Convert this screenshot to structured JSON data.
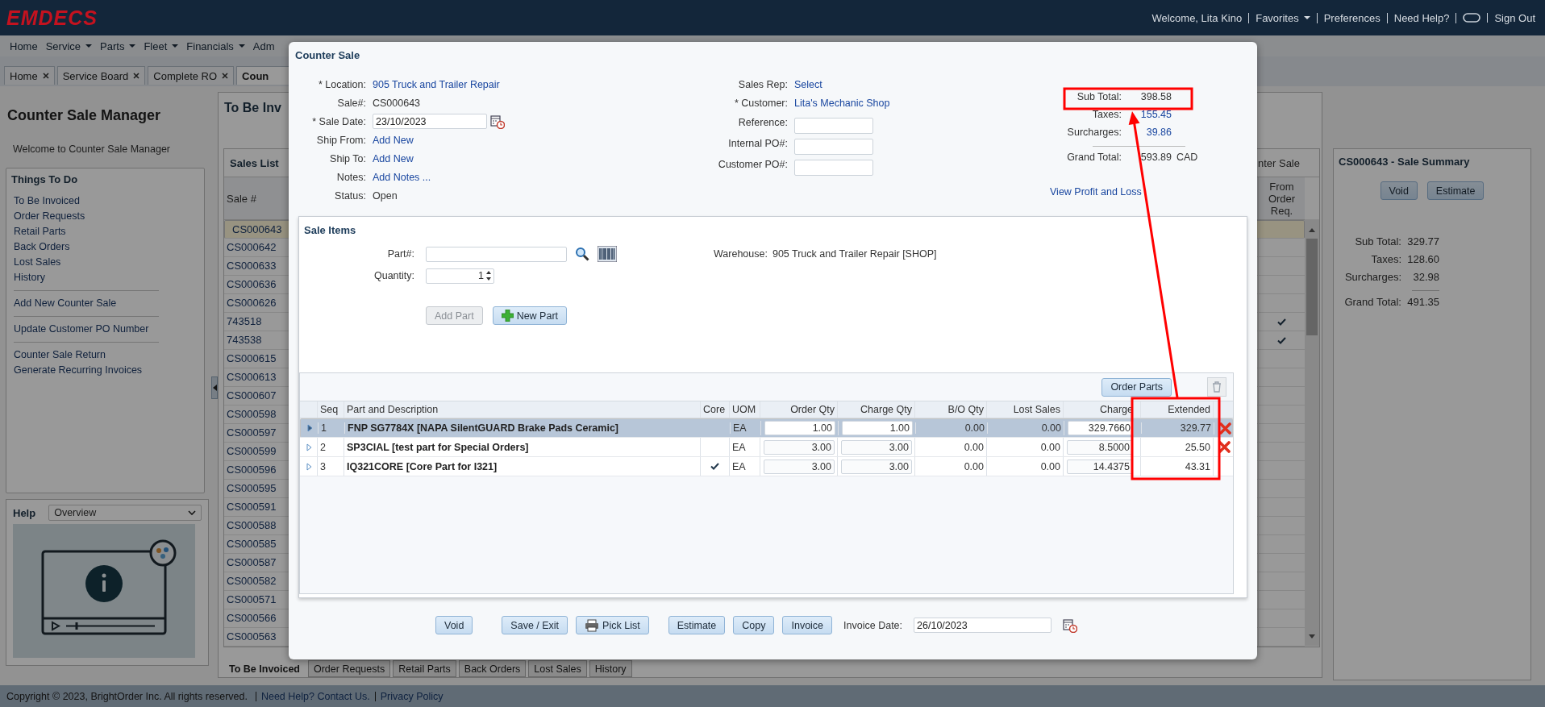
{
  "header": {
    "logo": "EMDECS",
    "links": [
      {
        "kind": "text",
        "text": "Welcome, Lita Kino"
      },
      {
        "kind": "menu",
        "text": "Favorites"
      },
      {
        "kind": "link",
        "text": "Preferences"
      },
      {
        "kind": "link",
        "text": "Need Help?"
      },
      {
        "kind": "icon"
      },
      {
        "kind": "link",
        "text": "Sign Out"
      }
    ]
  },
  "nav": [
    {
      "label": "Home",
      "menu": false
    },
    {
      "label": "Service",
      "menu": true
    },
    {
      "label": "Parts",
      "menu": true
    },
    {
      "label": "Fleet",
      "menu": true
    },
    {
      "label": "Financials",
      "menu": true
    },
    {
      "label": "Adm",
      "menu": false
    }
  ],
  "page_tabs": [
    {
      "label": "Home",
      "closable": true,
      "selected": false
    },
    {
      "label": "Service Board",
      "closable": true,
      "selected": false
    },
    {
      "label": "Complete RO",
      "closable": true,
      "selected": false
    },
    {
      "label": "Coun",
      "closable": false,
      "selected": true
    }
  ],
  "manager": {
    "title": "Counter Sale Manager",
    "welcome": "Welcome to Counter Sale Manager",
    "todo_title": "Things To Do",
    "todo_groups": [
      [
        "To Be Invoiced",
        "Order Requests",
        "Retail Parts",
        "Back Orders",
        "Lost Sales",
        "History"
      ],
      [
        "Add New Counter Sale"
      ],
      [
        "Update Customer PO Number"
      ],
      [
        "Counter Sale Return",
        "Generate Recurring Invoices"
      ]
    ],
    "help_title": "Help",
    "help_topic": "Overview"
  },
  "sales": {
    "title": "To Be Inv",
    "list_title": "Sales List",
    "header_fragment": "nter Sale",
    "columns": [
      "Sale #",
      "From Order Req."
    ],
    "rows": [
      {
        "sale": "CS000643",
        "selected": true,
        "from_order_req": false
      },
      {
        "sale": "CS000642",
        "selected": false,
        "from_order_req": false
      },
      {
        "sale": "CS000633",
        "selected": false,
        "from_order_req": false
      },
      {
        "sale": "CS000636",
        "selected": false,
        "from_order_req": false
      },
      {
        "sale": "CS000626",
        "selected": false,
        "from_order_req": false
      },
      {
        "sale": "743518",
        "selected": false,
        "from_order_req": true
      },
      {
        "sale": "743538",
        "selected": false,
        "from_order_req": true
      },
      {
        "sale": "CS000615",
        "selected": false,
        "from_order_req": false
      },
      {
        "sale": "CS000613",
        "selected": false,
        "from_order_req": false
      },
      {
        "sale": "CS000607",
        "selected": false,
        "from_order_req": false
      },
      {
        "sale": "CS000598",
        "selected": false,
        "from_order_req": false
      },
      {
        "sale": "CS000597",
        "selected": false,
        "from_order_req": false
      },
      {
        "sale": "CS000599",
        "selected": false,
        "from_order_req": false
      },
      {
        "sale": "CS000596",
        "selected": false,
        "from_order_req": false
      },
      {
        "sale": "CS000595",
        "selected": false,
        "from_order_req": false
      },
      {
        "sale": "CS000591",
        "selected": false,
        "from_order_req": false
      },
      {
        "sale": "CS000588",
        "selected": false,
        "from_order_req": false
      },
      {
        "sale": "CS000585",
        "selected": false,
        "from_order_req": false
      },
      {
        "sale": "CS000587",
        "selected": false,
        "from_order_req": false
      },
      {
        "sale": "CS000582",
        "selected": false,
        "from_order_req": false
      },
      {
        "sale": "CS000571",
        "selected": false,
        "from_order_req": false
      },
      {
        "sale": "CS000566",
        "selected": false,
        "from_order_req": false
      },
      {
        "sale": "CS000563",
        "selected": false,
        "from_order_req": false
      }
    ],
    "tabs": [
      {
        "label": "To Be Invoiced",
        "selected": true
      },
      {
        "label": "Order Requests",
        "selected": false
      },
      {
        "label": "Retail Parts",
        "selected": false
      },
      {
        "label": "Back Orders",
        "selected": false
      },
      {
        "label": "Lost Sales",
        "selected": false
      },
      {
        "label": "History",
        "selected": false
      }
    ]
  },
  "summary": {
    "title": "CS000643 - Sale Summary",
    "buttons": [
      "Void",
      "Estimate"
    ],
    "totals": [
      {
        "kind": "line",
        "label": "Sub Total:",
        "value": "329.77"
      },
      {
        "kind": "line",
        "label": "Taxes:",
        "value": "128.60"
      },
      {
        "kind": "line",
        "label": "Surcharges:",
        "value": "32.98"
      },
      {
        "kind": "grand",
        "label": "Grand Total:",
        "value": "491.35"
      }
    ]
  },
  "footer": {
    "copyright": "Copyright © 2023, BrightOrder Inc. All rights reserved.",
    "links": [
      "Need Help? Contact Us.",
      "Privacy Policy"
    ]
  },
  "dialog": {
    "title": "Counter Sale",
    "left_fields": [
      {
        "kind": "link",
        "label": "* Location:",
        "value": "905 Truck and Trailer Repair"
      },
      {
        "kind": "text",
        "label": "Sale#:",
        "value": "CS000643"
      },
      {
        "kind": "date",
        "label": "* Sale Date:",
        "value": "23/10/2023"
      },
      {
        "kind": "link",
        "label": "Ship From:",
        "value": "Add New"
      },
      {
        "kind": "link",
        "label": "Ship To:",
        "value": "Add New"
      },
      {
        "kind": "link",
        "label": "Notes:",
        "value": "Add Notes ..."
      },
      {
        "kind": "text",
        "label": "Status:",
        "value": "Open"
      }
    ],
    "middle_fields": [
      {
        "kind": "link",
        "label": "Sales Rep:",
        "value": "Select"
      },
      {
        "kind": "link",
        "label": "* Customer:",
        "value": "Lita's Mechanic Shop"
      },
      {
        "kind": "input",
        "label": "Reference:"
      },
      {
        "kind": "input",
        "label": "Internal PO#:"
      },
      {
        "kind": "input",
        "label": "Customer PO#:"
      }
    ],
    "totals": [
      {
        "kind": "plain",
        "label": "Sub Total:",
        "value": "398.58"
      },
      {
        "kind": "link",
        "label": "Taxes:",
        "value": "155.45"
      },
      {
        "kind": "link",
        "label": "Surcharges:",
        "value": "39.86"
      },
      {
        "kind": "grand",
        "label": "Grand Total:",
        "value": "593.89",
        "currency": "CAD"
      }
    ],
    "profit_link": "View Profit and Loss",
    "items": {
      "title": "Sale Items",
      "part_label": "Part#:",
      "quantity_label": "Quantity:",
      "quantity": "1",
      "warehouse_label": "Warehouse:",
      "warehouse": "905 Truck and Trailer Repair [SHOP]",
      "add_part": {
        "label": "Add Part",
        "disabled": true
      },
      "new_part": "New Part",
      "order_parts": "Order Parts",
      "columns": [
        "Seq",
        "Part and Description",
        "Core",
        "UOM",
        "Order Qty",
        "Charge Qty",
        "B/O Qty",
        "Lost Sales",
        "Charge",
        "Extended"
      ],
      "rows": [
        {
          "seq": "1",
          "part": "FNP SG7784X [NAPA SilentGUARD Brake Pads Ceramic]",
          "core": false,
          "uom": "EA",
          "order_qty": "1.00",
          "charge_qty": "1.00",
          "bo_qty": "0.00",
          "lost_sales": "0.00",
          "charge": "329.7660",
          "extended": "329.77",
          "selected": true,
          "deletable": true
        },
        {
          "seq": "2",
          "part": "SP3CIAL [test part for Special Orders]",
          "core": false,
          "uom": "EA",
          "order_qty": "3.00",
          "charge_qty": "3.00",
          "bo_qty": "0.00",
          "lost_sales": "0.00",
          "charge": "8.5000",
          "extended": "25.50",
          "selected": false,
          "deletable": true
        },
        {
          "seq": "3",
          "part": "IQ321CORE [Core Part for I321]",
          "core": true,
          "uom": "EA",
          "order_qty": "3.00",
          "charge_qty": "3.00",
          "bo_qty": "0.00",
          "lost_sales": "0.00",
          "charge": "14.4375",
          "extended": "43.31",
          "selected": false,
          "deletable": false
        }
      ]
    },
    "buttons": [
      {
        "kind": "plain",
        "label": "Void"
      },
      {
        "kind": "plain",
        "label": "Save / Exit"
      },
      {
        "kind": "print",
        "label": "Pick List"
      },
      {
        "kind": "plain",
        "label": "Estimate"
      },
      {
        "kind": "plain",
        "label": "Copy"
      },
      {
        "kind": "plain",
        "label": "Invoice"
      }
    ],
    "invoice_date_label": "Invoice Date:",
    "invoice_date": "26/10/2023"
  },
  "annotation": {
    "subtotal_box": true,
    "extended_box": true,
    "arrow": true
  }
}
